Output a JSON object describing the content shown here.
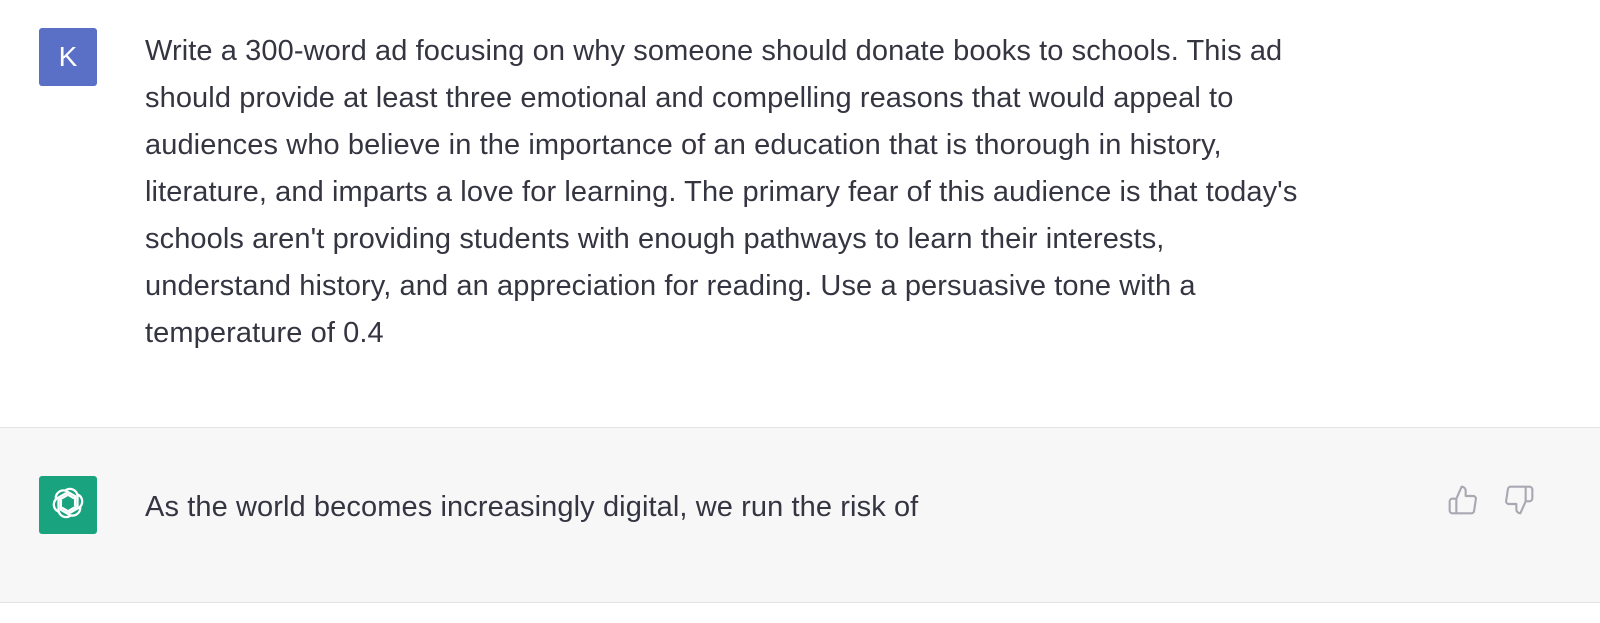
{
  "user_message": {
    "avatar_letter": "K",
    "avatar_color": "#5a6fc6",
    "lines": [
      "Write a 300-word ad focusing on why someone should donate books to schools. This ad",
      "should provide at least three emotional and compelling reasons that would appeal to",
      "audiences who believe in the importance of an education that is thorough in history,",
      "literature, and imparts a love for learning. The primary fear of this audience is that today's",
      "schools aren't providing students with enough pathways to learn their interests,",
      "understand history, and an appreciation for reading. Use a persuasive tone with a",
      "temperature of 0.4"
    ]
  },
  "assistant_message": {
    "avatar_icon": "openai-logo-icon",
    "avatar_color": "#19a37f",
    "text": "As the world becomes increasingly digital, we run the risk of",
    "feedback": {
      "thumbs_up_icon": "thumbs-up-icon",
      "thumbs_down_icon": "thumbs-down-icon"
    }
  }
}
